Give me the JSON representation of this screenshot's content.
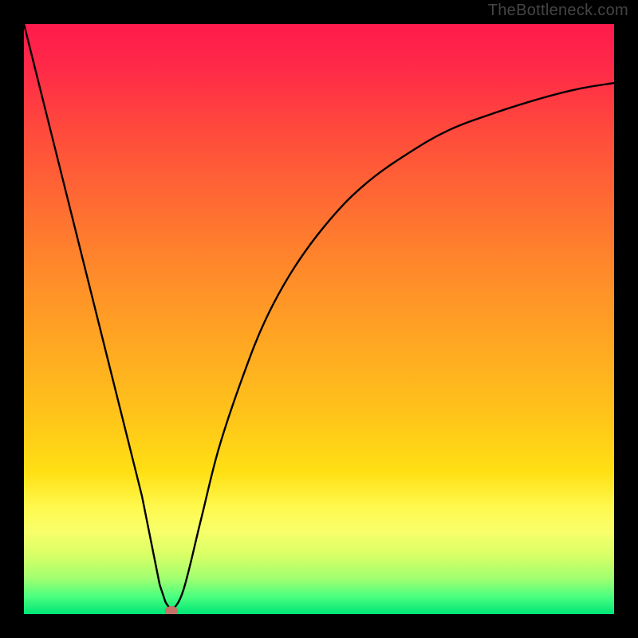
{
  "watermark": "TheBottleneck.com",
  "colors": {
    "frame": "#000000",
    "curve": "#000000",
    "marker": "#c77168"
  },
  "chart_data": {
    "type": "line",
    "title": "",
    "xlabel": "",
    "ylabel": "",
    "xlim": [
      0,
      100
    ],
    "ylim": [
      0,
      100
    ],
    "grid": false,
    "legend": false,
    "series": [
      {
        "name": "bottleneck-curve",
        "x": [
          0,
          2,
          5,
          8,
          11,
          14,
          17,
          20,
          22,
          23,
          24,
          25,
          27,
          30,
          33,
          37,
          41,
          46,
          52,
          58,
          65,
          72,
          80,
          88,
          94,
          100
        ],
        "y": [
          100,
          92,
          80,
          68,
          56,
          44,
          32,
          20,
          10,
          5,
          2,
          0.5,
          4,
          16,
          28,
          40,
          50,
          59,
          67,
          73,
          78,
          82,
          85,
          87.5,
          89,
          90
        ]
      }
    ],
    "marker": {
      "x": 25,
      "y": 0.5
    },
    "gradient_stops": [
      {
        "pos": 0,
        "color": "#ff1a4d"
      },
      {
        "pos": 18,
        "color": "#ff4a3c"
      },
      {
        "pos": 42,
        "color": "#ff8a2a"
      },
      {
        "pos": 66,
        "color": "#ffc31a"
      },
      {
        "pos": 82,
        "color": "#fff94f"
      },
      {
        "pos": 94,
        "color": "#a0ff70"
      },
      {
        "pos": 100,
        "color": "#00e676"
      }
    ]
  }
}
